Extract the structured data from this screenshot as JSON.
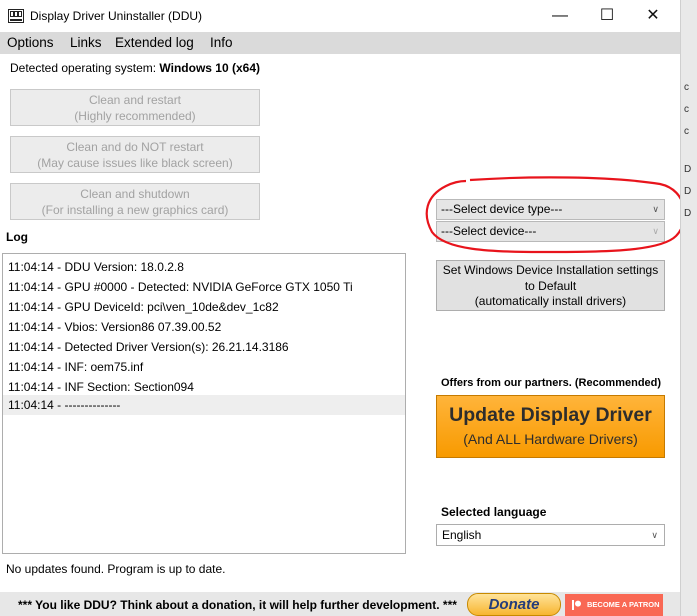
{
  "window": {
    "title": "Display Driver Uninstaller (DDU)",
    "controls": {
      "minimize": "—",
      "maximize": "☐",
      "close": "✕"
    }
  },
  "menu": [
    "Options",
    "Links",
    "Extended log",
    "Info"
  ],
  "os": {
    "label": "Detected operating system: ",
    "value": "Windows 10 (x64)"
  },
  "actions": [
    {
      "line1": "Clean and restart",
      "line2": "(Highly recommended)"
    },
    {
      "line1": "Clean and do NOT restart",
      "line2": "(May cause issues like black screen)"
    },
    {
      "line1": "Clean and shutdown",
      "line2": "(For installing a new graphics card)"
    }
  ],
  "log": {
    "label": "Log",
    "entries": [
      "11:04:14 - DDU Version: 18.0.2.8",
      "11:04:14 - GPU #0000 - Detected: NVIDIA GeForce GTX 1050 Ti",
      "11:04:14 - GPU DeviceId: pci\\ven_10de&dev_1c82",
      "11:04:14 - Vbios: Version86 07.39.00.52",
      "11:04:14 - Detected Driver Version(s): 26.21.14.3186",
      "11:04:14 - INF: oem75.inf",
      "11:04:14 - INF Section: Section094",
      "11:04:14 - --------------"
    ]
  },
  "status": "No updates found. Program is up to date.",
  "device_type": {
    "value": "---Select device type---"
  },
  "device": {
    "value": "---Select device---"
  },
  "win_settings": {
    "line1": "Set Windows Device Installation settings",
    "line2": "to Default",
    "line3": "(automatically install drivers)"
  },
  "partners": {
    "label": "Offers from our partners. (Recommended)",
    "banner_title": "Update Display Driver",
    "banner_sub": "(And ALL Hardware Drivers)"
  },
  "language": {
    "label": "Selected language",
    "value": "English"
  },
  "donation": {
    "text": "*** You like DDU? Think about a donation, it will help further development. ***",
    "donate_label": "Donate",
    "patron_label": "BECOME A PATRON"
  },
  "background_fragments": [
    "c",
    "c",
    "c",
    "D",
    "D",
    "D"
  ],
  "colors": {
    "annotation": "#e8141c",
    "banner": "#f89a00",
    "patreon": "#f96854"
  }
}
